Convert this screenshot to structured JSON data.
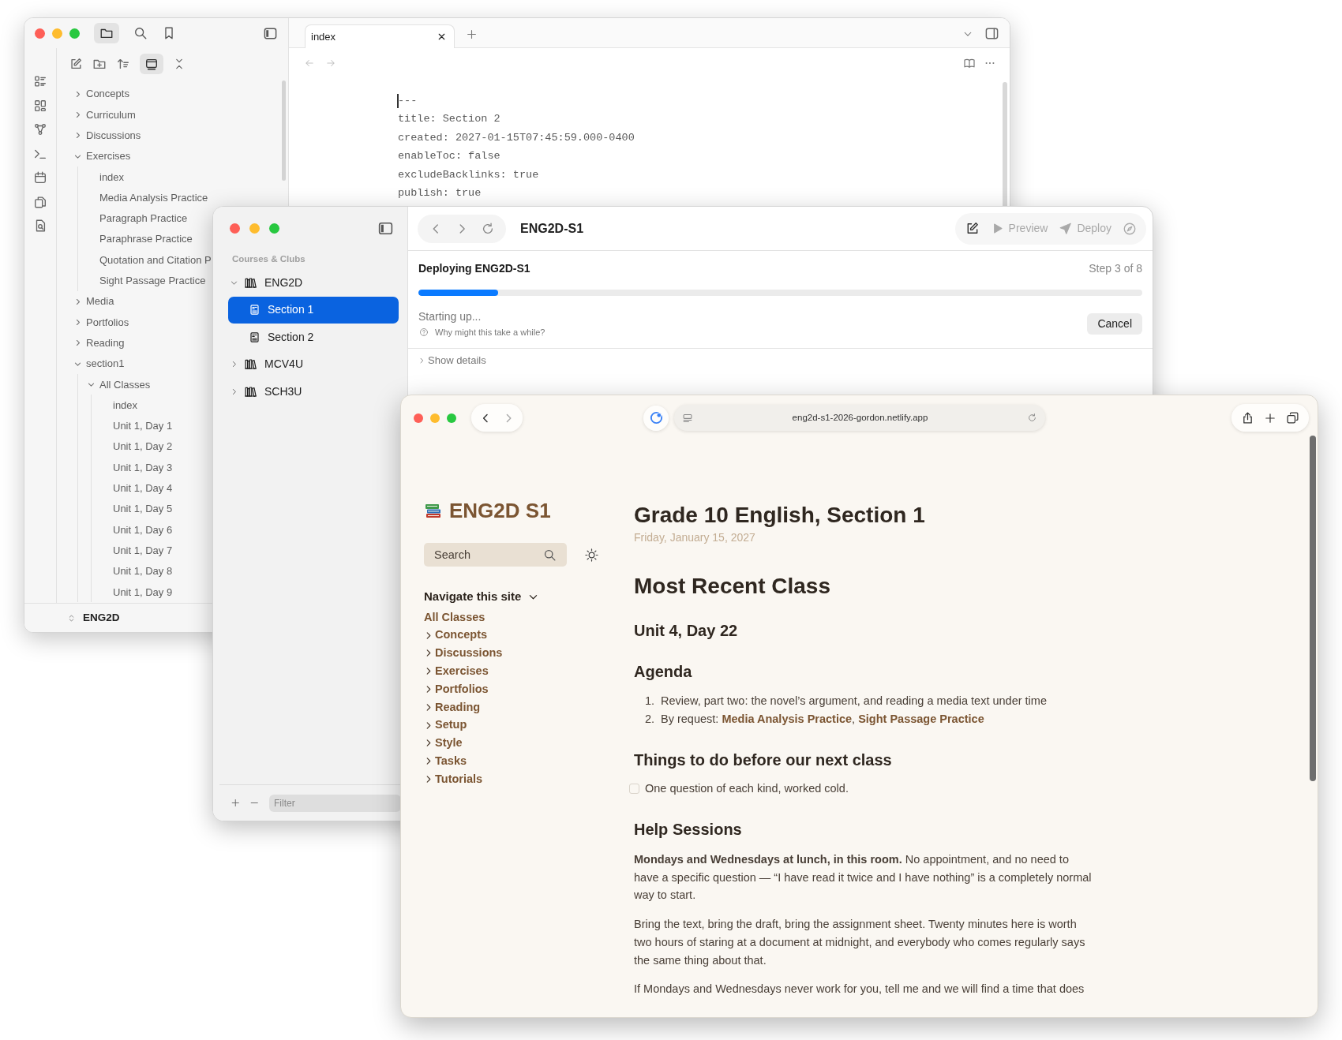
{
  "notes_window": {
    "file_tree": [
      {
        "label": "Concepts",
        "expanded": false
      },
      {
        "label": "Curriculum",
        "expanded": false
      },
      {
        "label": "Discussions",
        "expanded": false
      },
      {
        "label": "Exercises",
        "expanded": true,
        "children": [
          {
            "label": "index"
          },
          {
            "label": "Media Analysis Practice"
          },
          {
            "label": "Paragraph Practice"
          },
          {
            "label": "Paraphrase Practice"
          },
          {
            "label": "Quotation and Citation P"
          },
          {
            "label": "Sight Passage Practice"
          }
        ]
      },
      {
        "label": "Media",
        "expanded": false
      },
      {
        "label": "Portfolios",
        "expanded": false
      },
      {
        "label": "Reading",
        "expanded": false
      },
      {
        "label": "section1",
        "expanded": true,
        "children": [
          {
            "label": "All Classes",
            "expanded": true,
            "children": [
              {
                "label": "index"
              },
              {
                "label": "Unit 1, Day 1"
              },
              {
                "label": "Unit 1, Day 2"
              },
              {
                "label": "Unit 1, Day 3"
              },
              {
                "label": "Unit 1, Day 4"
              },
              {
                "label": "Unit 1, Day 5"
              },
              {
                "label": "Unit 1, Day 6"
              },
              {
                "label": "Unit 1, Day 7"
              },
              {
                "label": "Unit 1, Day 8"
              },
              {
                "label": "Unit 1, Day 9"
              }
            ]
          }
        ]
      }
    ],
    "vault_name": "ENG2D",
    "tabs": [
      {
        "label": "index",
        "selected": true
      }
    ],
    "frontmatter": [
      "---",
      "title: Section 2",
      "created: 2027-01-15T07:45:59.000-0400",
      "enableToc: false",
      "excludeBacklinks: true",
      "publish: true"
    ]
  },
  "deploy_window": {
    "title": "ENG2D-S1",
    "sidebar": {
      "heading": "Courses & Clubs",
      "items": [
        {
          "label": "ENG2D",
          "kind": "course",
          "expanded": true,
          "selected": false,
          "children": [
            {
              "label": "Section 1",
              "kind": "section",
              "selected": true
            },
            {
              "label": "Section 2",
              "kind": "section",
              "selected": false
            }
          ]
        },
        {
          "label": "MCV4U",
          "kind": "course",
          "expanded": false,
          "selected": false
        },
        {
          "label": "SCH3U",
          "kind": "course",
          "expanded": false,
          "selected": false
        }
      ]
    },
    "toolbar_buttons": [
      {
        "label": "Preview",
        "kind": "preview",
        "disabled": true
      },
      {
        "label": "Deploy",
        "kind": "deploy",
        "disabled": true
      }
    ],
    "deploy": {
      "title": "Deploying ENG2D-S1",
      "step": "Step 3 of 8",
      "level": 0.11,
      "status": "Starting up...",
      "help": "Why might this take a while?",
      "cancel": "Cancel",
      "details": "Show details"
    },
    "filter": {
      "placeholder": "Filter"
    }
  },
  "browser_window": {
    "url": "eng2d-s1-2026-gordon.netlify.app",
    "site_title": "ENG2D S1",
    "search": {
      "placeholder": "Search"
    },
    "nav_heading": "Navigate this site",
    "nav": [
      {
        "label": "All Classes",
        "kind": "page"
      },
      {
        "label": "Concepts",
        "kind": "section"
      },
      {
        "label": "Discussions",
        "kind": "section"
      },
      {
        "label": "Exercises",
        "kind": "section"
      },
      {
        "label": "Portfolios",
        "kind": "section"
      },
      {
        "label": "Reading",
        "kind": "section"
      },
      {
        "label": "Setup",
        "kind": "section"
      },
      {
        "label": "Style",
        "kind": "section"
      },
      {
        "label": "Tasks",
        "kind": "section"
      },
      {
        "label": "Tutorials",
        "kind": "section"
      }
    ],
    "page": {
      "title": "Grade 10 English, Section 1",
      "date": "Friday, January 15, 2027",
      "heading": "Most Recent Class",
      "class_title": "Unit 4, Day 22",
      "agenda_heading": "Agenda",
      "agenda": [
        {
          "number": "1.",
          "segments": [
            {
              "kind": "text",
              "text": "Review, part two: the novel’s argument, and reading a media text under time"
            }
          ]
        },
        {
          "number": "2.",
          "segments": [
            {
              "kind": "text",
              "text": "By request: "
            },
            {
              "kind": "link",
              "text": "Media Analysis Practice"
            },
            {
              "kind": "text",
              "text": ", "
            },
            {
              "kind": "link",
              "text": "Sight Passage Practice"
            }
          ]
        }
      ],
      "todo_heading": "Things to do before our next class",
      "todos": [
        {
          "text": "One question of each kind, worked cold.",
          "checked": false
        }
      ],
      "help_heading": "Help Sessions",
      "paragraphs": [
        "**Mondays and Wednesdays at lunch, in this room.** No appointment, and no need to have a specific question — “I have read it twice and I have nothing” is a completely normal way to start.",
        "Bring the text, bring the draft, bring the assignment sheet. Twenty minutes here is worth two hours of staring at a document at midnight, and everybody who comes regularly says the same thing about that.",
        "If Mondays and Wednesdays never work for you, tell me and we will find a time that does"
      ]
    }
  }
}
